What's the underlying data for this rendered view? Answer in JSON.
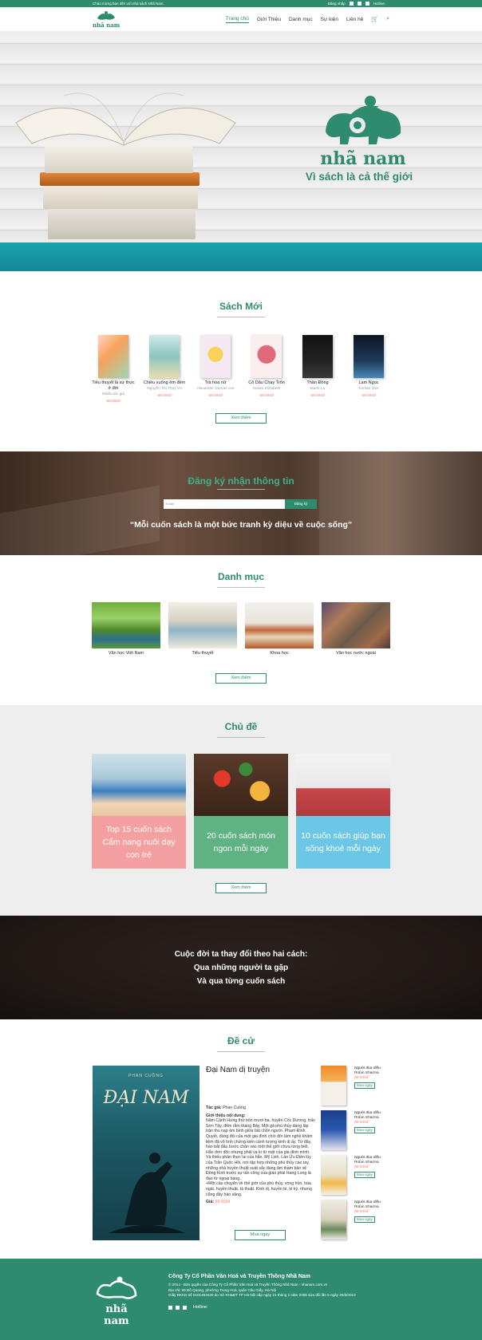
{
  "topbar": {
    "welcome": "Chào mừng bạn đến với nhà sách Nhã Nam",
    "login": "Đăng nhập",
    "hotline_label": "Hotline:",
    "hotline_value": ""
  },
  "nav": {
    "logo_text": "nhã nam",
    "items": [
      "Trang chủ",
      "Giới Thiệu",
      "Danh mục",
      "Sự kiện",
      "Liên hệ"
    ],
    "cart_icon": "cart-icon",
    "search_icon": "search-icon"
  },
  "hero": {
    "brand": "nhã nam",
    "slogan": "Vì sách là cả thế giới"
  },
  "new_books": {
    "title": "Sách Mới",
    "button": "Xem thêm",
    "items": [
      {
        "title": "Tiểu thuyết là sự thực ở đời",
        "author": "Nhiều tác giả",
        "price": "99.000đ"
      },
      {
        "title": "Chiều xuống êm đềm",
        "author": "Nguyễn Thị Thuỳ Vũ",
        "price": "99.000đ"
      },
      {
        "title": "Trà hoa nữ",
        "author": "Alexander Dumas con",
        "price": "99.000đ"
      },
      {
        "title": "Cô Dâu Chạy Trốn",
        "author": "Susan Elizabeth",
        "price": "99.000đ"
      },
      {
        "title": "Thần Đồng",
        "author": "Marie Lu",
        "price": "99.000đ"
      },
      {
        "title": "Lam Ngọc",
        "author": "Kerstin Gier",
        "price": "99.000đ"
      }
    ]
  },
  "subscribe": {
    "title": "Đăng ký nhận thông tin",
    "placeholder": "Email",
    "button": "Đăng ký",
    "quote": "“Mỗi cuốn sách là một bức tranh kỳ diệu về cuộc sống”"
  },
  "categories": {
    "title": "Danh mục",
    "button": "Xem thêm",
    "items": [
      "Văn học Việt Nam",
      "Tiểu thuyết",
      "Khoa học",
      "Văn học nước ngoài"
    ]
  },
  "topics": {
    "title": "Chủ đề",
    "button": "Xem thêm",
    "items": [
      {
        "label": "Top 15 cuốn sách Cẩm nang nuôi dạy con trẻ",
        "color": "#f4a0a0"
      },
      {
        "label": "20 cuốn sách món ngon mỗi ngày",
        "color": "#5fb383"
      },
      {
        "label": "10 cuốn sách giúp bạn sống khoẻ mỗi ngày",
        "color": "#6cc7e6"
      }
    ]
  },
  "banner": {
    "lines": [
      "Cuộc đời ta thay đổi theo hai cách:",
      "Qua những người ta gặp",
      "Và qua từng cuốn sách"
    ]
  },
  "recommend": {
    "title": "Đề cử",
    "book_title": "Đại Nam dị truyện",
    "cover_author": "PHAN CUỒNG",
    "cover_title": "ĐẠI NAM",
    "author_label": "Tác giả:",
    "author": "Phan Cuồng",
    "intro_label": "Giới thiệu nội dung:",
    "intro": "Năm Cảnh Hưng thứ bốn mươi ba, huyện Cốc Dương, trấn Sơn Tây, đêm rằm tháng Bảy. Một gã phù thủy đang lập trận thu nạp âm binh giữa bãi chôn người. Phạm Đình Quyết, đúng đồi của một gia đình chín đời làm nghề khâm liệm đã vô tình chứng kiến cảnh tượng kinh dị ấy. Từ đây, hàn bắt đầu bước chân vào một thế giới chưa từng biết. Hắn đơn độc nhưng phải vạ lo từ mật của gia đình mình. Và thiếu phản thực lai của hắn, Mỹ Linh, Lần Ửu Điền lùy của Trấn Quốc Hồi, nơi tập hợp những phù thủy cao tay, những nhà huyền thuật xuất sắc đang âm thầm bảo vệ Đông Kinh trước sự tấn công của giáo phái Hang Long là đạo từ ngoại bang.",
    "intro2": "+Một câu chuyện về thế giới của phù thủy, vong hồn, bùa ngải, huyền thuật, tà thuật. Kinh dị, huyền bí, kì kỳ, nhưng cũng đầy hào sảng.",
    "price_label": "Giá:",
    "price": "99.000đ",
    "buy_button": "Mua ngay",
    "side": [
      {
        "name": "Người đua diều",
        "author": "Robin Sharma",
        "price": "99.000đ",
        "button": "Mua ngay"
      },
      {
        "name": "Người đua diều",
        "author": "Robin Sharma",
        "price": "99.000đ",
        "button": "Mua ngay"
      },
      {
        "name": "Người đua diều",
        "author": "Robin Sharma",
        "price": "99.000đ",
        "button": "Mua ngay"
      },
      {
        "name": "Người đua diều",
        "author": "Robin Sharma",
        "price": "99.000đ",
        "button": "Mua ngay"
      }
    ]
  },
  "footer": {
    "logo_text": "nhã nam",
    "company": "Công Ty Cổ Phần Văn Hoá và Truyền Thông Nhã Nam",
    "copyright": "© 2014 - Bản quyền của Công Ty Cổ Phần Văn Hoá và Truyền Thông Nhã Nam - nhanam.com.vn",
    "address": "Địa chỉ: 59 Đỗ Quang, phường Trung Hoà, quận Cầu Giấy, Hà Nội",
    "license": "Giấy ĐKKD số 0101453420 do Sở KH&ĐT TP Hà Nội cấp ngày 21 tháng 1 năm 2005 sửa đổi lần 5 ngày 20/3/2013",
    "hotline_label": "Hotline:",
    "hotline_value": ""
  },
  "colors": {
    "brand": "#2e8b6e",
    "price": "#ff7a6a"
  }
}
